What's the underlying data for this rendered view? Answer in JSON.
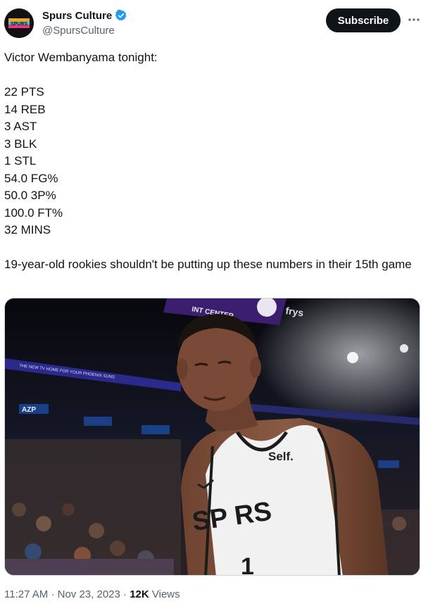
{
  "author": {
    "name": "Spurs Culture",
    "handle": "@SpursCulture",
    "avatar_text": "SPURS",
    "verified_color": "#1d9bf0"
  },
  "actions": {
    "subscribe_label": "Subscribe",
    "more_icon": "more-icon"
  },
  "tweet": {
    "intro": "Victor Wembanyama tonight:",
    "stats": [
      "22 PTS",
      "14 REB",
      "3 AST",
      "3 BLK",
      "1 STL",
      "54.0 FG%",
      "50.0 3P%",
      "100.0 FT%",
      "32 MINS"
    ],
    "closing": "19-year-old rookies shouldn't be putting up these numbers in their 15th game"
  },
  "photo": {
    "arena_sign": "INT CENTER",
    "arena_logo": "frys",
    "ribbon_text": "THE NEW TV HOME FOR YOUR PHOENIX SUNS",
    "ad_text": "AZP",
    "jersey_sponsor": "Self.",
    "jersey_team": "SP RS",
    "jersey_number": "1"
  },
  "meta": {
    "time": "11:27 AM",
    "separator": "·",
    "date": "Nov 23, 2023",
    "views_count": "12K",
    "views_label": "Views"
  }
}
